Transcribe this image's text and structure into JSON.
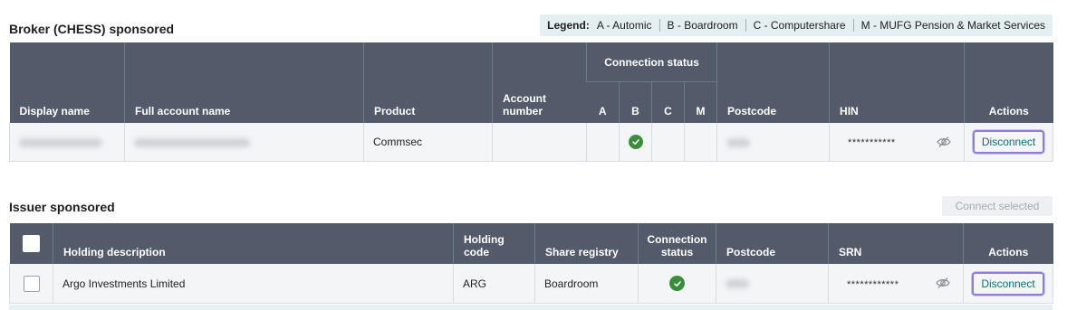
{
  "broker": {
    "title": "Broker (CHESS) sponsored",
    "legend": {
      "title": "Legend:",
      "items": [
        "A - Automic",
        "B - Boardroom",
        "C - Computershare",
        "M - MUFG Pension & Market Services"
      ]
    },
    "headers": {
      "display_name": "Display name",
      "full_account_name": "Full account name",
      "product": "Product",
      "account_number": "Account number",
      "connection_status": "Connection status",
      "a": "A",
      "b": "B",
      "c": "C",
      "m": "M",
      "postcode": "Postcode",
      "hin": "HIN",
      "actions": "Actions"
    },
    "rows": [
      {
        "product": "Commsec",
        "hin": "***********",
        "status_b": "connected",
        "action": "Disconnect"
      }
    ]
  },
  "issuer": {
    "title": "Issuer sponsored",
    "connect_selected": "Connect selected",
    "headers": {
      "holding_description": "Holding description",
      "holding_code": "Holding code",
      "share_registry": "Share registry",
      "connection_status": "Connection status",
      "postcode": "Postcode",
      "srn": "SRN",
      "actions": "Actions"
    },
    "rows": [
      {
        "holding_description": "Argo Investments Limited",
        "holding_code": "ARG",
        "share_registry": "Boardroom",
        "status": "connected",
        "srn": "************",
        "action": "Disconnect"
      }
    ]
  },
  "colors": {
    "header_bg": "#535b6b",
    "accent": "#106b76",
    "success": "#3c8c3c",
    "focus_ring": "#8e7ed6",
    "legend_bg": "#e3eff1"
  },
  "icons": {
    "status": "check-circle-icon",
    "visibility": "eye-slash-icon"
  }
}
